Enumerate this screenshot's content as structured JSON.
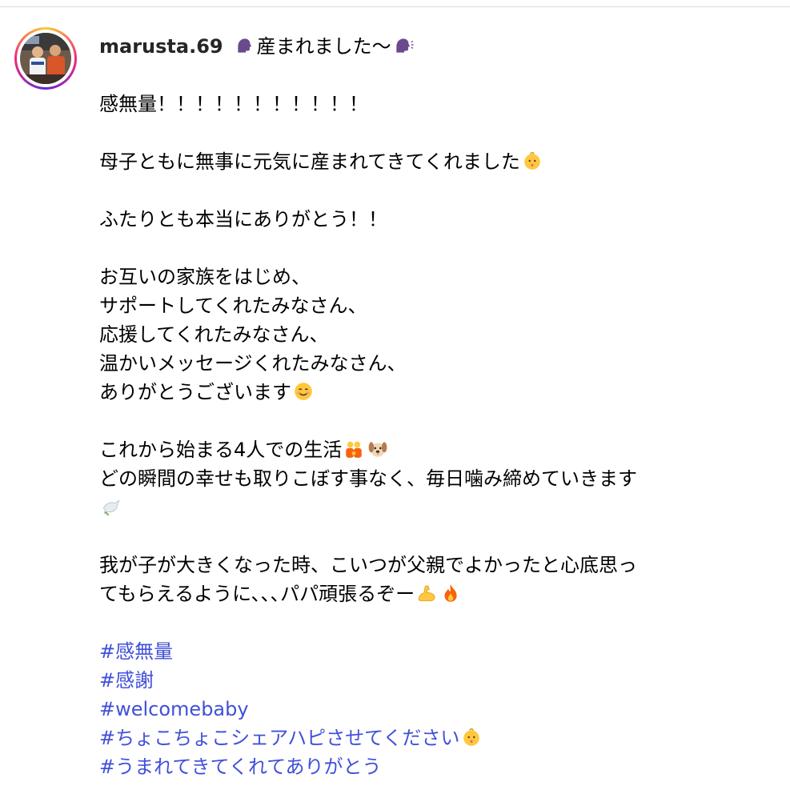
{
  "post": {
    "username": "marusta.69",
    "title_text": "産まれました〜",
    "lines": {
      "l1": "感無量！！！！！！！！！！！",
      "l2": "母子ともに無事に元気に産まれてきてくれました",
      "l3": "ふたりとも本当にありがとう！！",
      "l4": "お互いの家族をはじめ、",
      "l5": "サポートしてくれたみなさん、",
      "l6": "応援してくれたみなさん、",
      "l7": "温かいメッセージくれたみなさん、",
      "l8": "ありがとうございます",
      "l9": "これから始まる4人での生活",
      "l10": "どの瞬間の幸せも取りこぼす事なく、毎日噛み締めていきます",
      "l11": "我が子が大きくなった時、こいつが父親でよかったと心底思っ",
      "l12": "てもらえるように､､､パパ頑張るぞー"
    },
    "hashtags": [
      "#感無量",
      "#感謝",
      "#welcomebaby",
      "#ちょこちょこシェアハピさせてください",
      "#うまれてきてくれてありがとう"
    ],
    "emoji": {
      "speaking_head": "speaking-head-icon",
      "baby": "baby-icon",
      "smile": "smiling-face-icon",
      "couple": "couple-icon",
      "dog": "dog-face-icon",
      "dove": "dove-icon",
      "muscle": "flexed-biceps-icon",
      "fire": "fire-icon"
    },
    "colors": {
      "hashtag": "#4150d8",
      "ring_start": "#f9ce34",
      "ring_mid": "#ee2a7b",
      "ring_end": "#6228d7"
    }
  }
}
